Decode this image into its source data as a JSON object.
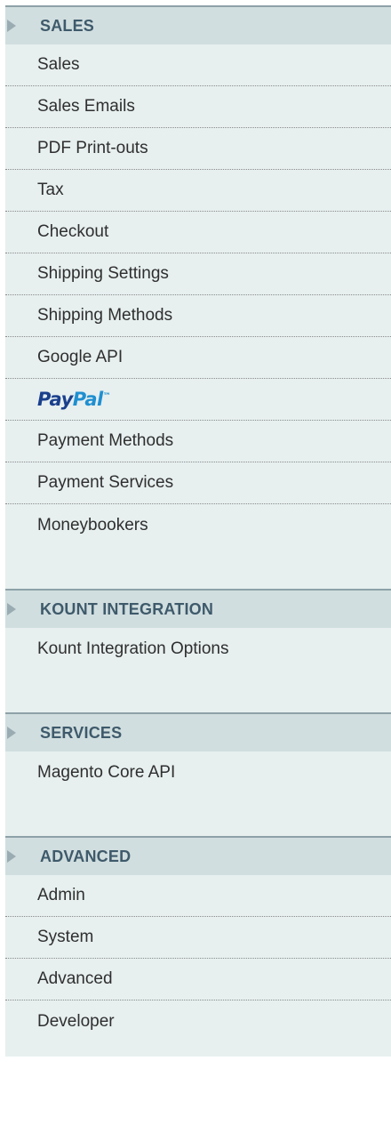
{
  "sections": [
    {
      "title": "SALES",
      "items": [
        "Sales",
        "Sales Emails",
        "PDF Print-outs",
        "Tax",
        "Checkout",
        "Shipping Settings",
        "Shipping Methods",
        "Google API",
        "PayPal",
        "Payment Methods",
        "Payment Services",
        "Moneybookers"
      ]
    },
    {
      "title": "KOUNT INTEGRATION",
      "items": [
        "Kount Integration Options"
      ]
    },
    {
      "title": "SERVICES",
      "items": [
        "Magento Core API"
      ]
    },
    {
      "title": "ADVANCED",
      "items": [
        "Admin",
        "System",
        "Advanced",
        "Developer"
      ]
    }
  ],
  "paypal_logo": {
    "pay": "Pay",
    "pal": "Pal",
    "colors": {
      "pay": "#1a3f8c",
      "pal": "#1f8fd0"
    }
  }
}
